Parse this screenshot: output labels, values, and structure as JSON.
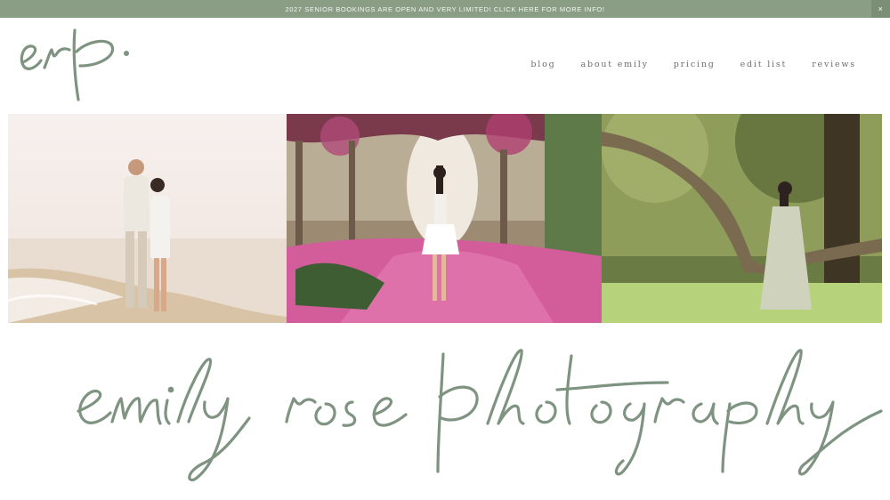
{
  "banner": {
    "text": "2027 SENIOR BOOKINGS ARE OPEN AND VERY LIMITED! CLICK HERE FOR MORE INFO!",
    "close_label": "×"
  },
  "logo": {
    "text": "erp."
  },
  "nav": {
    "items": [
      {
        "label": "blog"
      },
      {
        "label": "about emily"
      },
      {
        "label": "pricing"
      },
      {
        "label": "edit list"
      },
      {
        "label": "reviews"
      }
    ]
  },
  "wordmark": {
    "text": "emily rose photography"
  },
  "colors": {
    "brand_sage": "#8a9e86",
    "script_green": "#7f9381",
    "nav_text": "#6d6d6d"
  }
}
